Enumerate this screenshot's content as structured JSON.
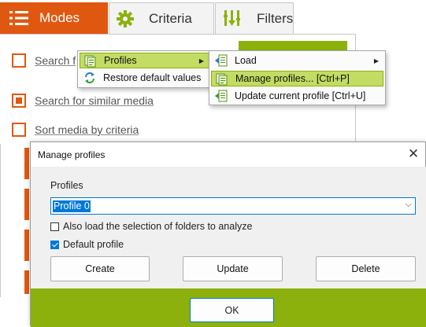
{
  "tabs": [
    {
      "label": "Modes",
      "icon": "list-icon",
      "active": true
    },
    {
      "label": "Criteria",
      "icon": "gear-icon",
      "active": false
    },
    {
      "label": "Filters",
      "icon": "filter-icon",
      "active": false
    }
  ],
  "modes": {
    "options": [
      {
        "label": "Search f",
        "checked": false
      },
      {
        "label": "Search for similar media",
        "checked": true
      },
      {
        "label": "Sort media by criteria",
        "checked": false
      }
    ]
  },
  "context_menu": {
    "items": [
      {
        "label": "Profiles",
        "icon": "profiles-icon",
        "has_submenu": true,
        "highlighted": true
      },
      {
        "label": "Restore default values",
        "icon": "refresh-icon",
        "has_submenu": false,
        "highlighted": false
      }
    ]
  },
  "submenu": {
    "items": [
      {
        "label": "Load",
        "icon": "load-icon",
        "has_submenu": true,
        "highlighted": false
      },
      {
        "label": "Manage profiles... [Ctrl+P]",
        "icon": "manage-profiles-icon",
        "has_submenu": false,
        "highlighted": true
      },
      {
        "label": "Update current profile  [Ctrl+U]",
        "icon": "update-profile-icon",
        "has_submenu": false,
        "highlighted": false
      }
    ]
  },
  "dialog": {
    "title": "Manage profiles",
    "profiles_label": "Profiles",
    "profile_value": "Profile 0",
    "checkbox_folders": {
      "label": "Also load the selection of folders to analyze",
      "checked": false
    },
    "checkbox_default": {
      "label": "Default profile",
      "checked": true
    },
    "buttons": {
      "create": "Create",
      "update": "Update",
      "delete": "Delete",
      "ok": "OK"
    }
  },
  "colors": {
    "accent_orange": "#e0580f",
    "accent_green": "#8cb10d",
    "highlight_green": "#c3dc63",
    "selection_blue": "#0078d7"
  }
}
